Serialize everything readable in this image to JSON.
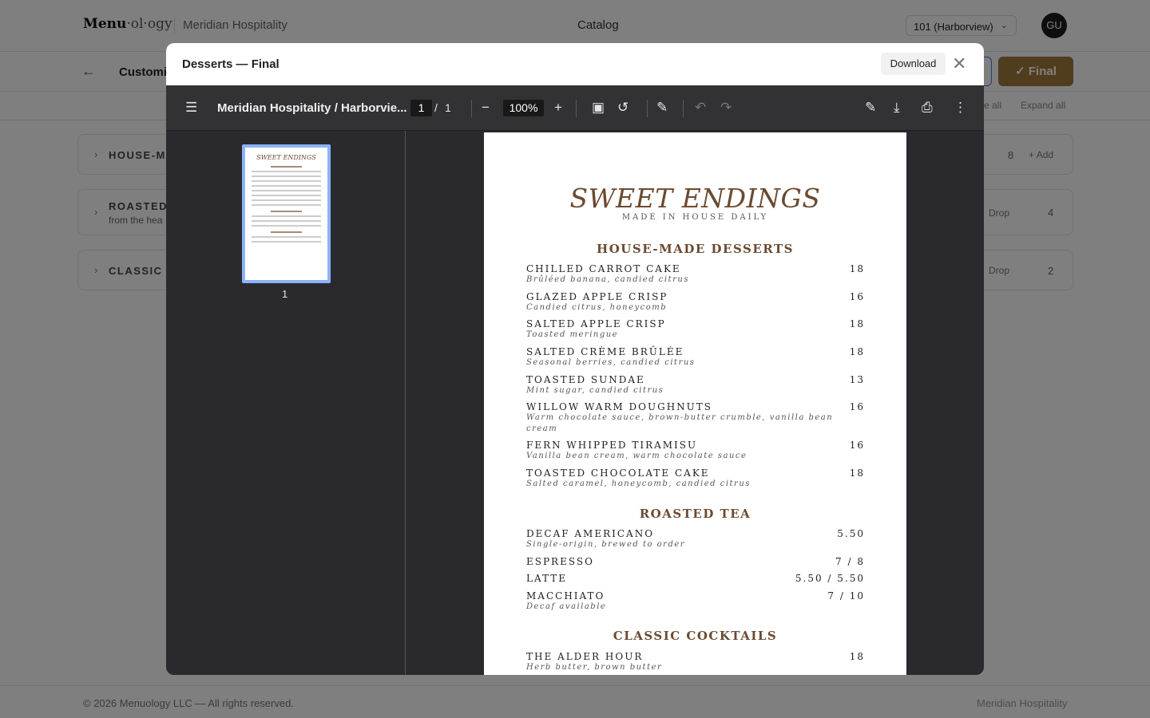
{
  "app": {
    "logo_bold": "Menu",
    "logo_rest": "·ol·ogy",
    "org": "Meridian Hospitality",
    "center_title": "Catalog",
    "location": "101 (Harborview)",
    "avatar_initials": "GU",
    "page_title": "Customiz",
    "final_label": "Final",
    "collapse_all": "e all",
    "expand_all": "Expand all"
  },
  "sections": [
    {
      "name": "HOUSE-MA",
      "subtitle": "",
      "count": "8",
      "right_text": "Add"
    },
    {
      "name": "ROASTED T",
      "subtitle": "from the hea",
      "count": "4",
      "right_text": "Drop"
    },
    {
      "name": "CLASSIC C",
      "subtitle": "",
      "count": "2",
      "right_text": "Drop"
    }
  ],
  "footer": {
    "copyright": "© 2026 Menuology LLC — All rights reserved.",
    "right": "Meridian Hospitality"
  },
  "modal": {
    "title": "Desserts — Final",
    "download_label": "Download"
  },
  "pdf": {
    "doc_name": "Meridian Hospitality / Harborvie...",
    "current_page": "1",
    "page_separator": "/",
    "total_pages": "1",
    "zoom": "100%",
    "thumb_number": "1"
  },
  "menu": {
    "title": "SWEET ENDINGS",
    "subtitle": "MADE IN HOUSE DAILY",
    "sections": [
      {
        "title": "HOUSE-MADE DESSERTS",
        "items": [
          {
            "name": "CHILLED CARROT CAKE",
            "price": "18",
            "desc": "Brûléed banana, candied citrus"
          },
          {
            "name": "GLAZED APPLE CRISP",
            "price": "16",
            "desc": "Candied citrus, honeycomb"
          },
          {
            "name": "SALTED APPLE CRISP",
            "price": "18",
            "desc": "Toasted meringue"
          },
          {
            "name": "SALTED CRÈME BRÛLÉE",
            "price": "18",
            "desc": "Seasonal berries, candied citrus"
          },
          {
            "name": "TOASTED SUNDAE",
            "price": "13",
            "desc": "Mint sugar, candied citrus"
          },
          {
            "name": "WILLOW WARM DOUGHNUTS",
            "price": "16",
            "desc": "Warm chocolate sauce, brown-butter crumble, vanilla bean cream"
          },
          {
            "name": "FERN WHIPPED TIRAMISU",
            "price": "16",
            "desc": "Vanilla bean cream, warm chocolate sauce"
          },
          {
            "name": "TOASTED CHOCOLATE CAKE",
            "price": "18",
            "desc": "Salted caramel, honeycomb, candied citrus"
          }
        ]
      },
      {
        "title": "ROASTED TEA",
        "items": [
          {
            "name": "DECAF AMERICANO",
            "price": "5.50",
            "desc": "Single-origin, brewed to order"
          },
          {
            "name": "ESPRESSO",
            "price": "7 / 8",
            "desc": ""
          },
          {
            "name": "LATTE",
            "price": "5.50 / 5.50",
            "desc": ""
          },
          {
            "name": "MACCHIATO",
            "price": "7 / 10",
            "desc": "Decaf available"
          }
        ]
      },
      {
        "title": "CLASSIC COCKTAILS",
        "items": [
          {
            "name": "THE ALDER HOUR",
            "price": "18",
            "desc": "Herb butter, brown butter"
          }
        ]
      }
    ]
  }
}
